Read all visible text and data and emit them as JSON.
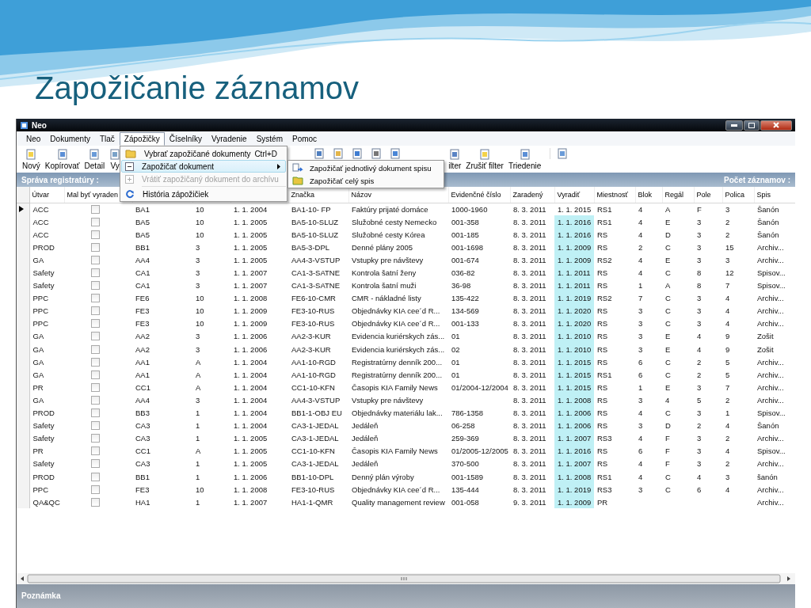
{
  "slide_title": "Zapožičanie záznamov",
  "window": {
    "title": "Neo"
  },
  "menu": [
    {
      "label": "Neo",
      "selected": false
    },
    {
      "label": "Dokumenty",
      "selected": false
    },
    {
      "label": "Tlač",
      "selected": false
    },
    {
      "label": "Zápožičky",
      "selected": true
    },
    {
      "label": "Číselníky",
      "selected": false
    },
    {
      "label": "Vyradenie",
      "selected": false
    },
    {
      "label": "Systém",
      "selected": false
    },
    {
      "label": "Pomoc",
      "selected": false
    }
  ],
  "dropdown": [
    {
      "label": "Vybrať zapožičané dokumenty",
      "shortcut": "Ctrl+D",
      "selected": false,
      "disabled": false
    },
    {
      "label": "Zapožičať dokument",
      "selected": true,
      "disabled": false,
      "submenu": [
        {
          "label": "Zapožičať jednotlivý dokument spisu"
        },
        {
          "label": "Zapožičať celý spis"
        }
      ]
    },
    {
      "label": "Vrátiť zapožičaný dokument do archívu",
      "selected": false,
      "disabled": true
    },
    {
      "label": "História zápožičiek",
      "selected": false,
      "disabled": false,
      "separator_before": true
    }
  ],
  "toolbar": [
    {
      "kind": "labeled",
      "label": "Nový"
    },
    {
      "kind": "labeled",
      "label": "Kopírovať"
    },
    {
      "kind": "labeled",
      "label": "Detail"
    },
    {
      "kind": "labeled",
      "label": "Vy"
    },
    {
      "kind": "icon"
    },
    {
      "kind": "icon"
    },
    {
      "kind": "icon"
    },
    {
      "kind": "icon"
    },
    {
      "kind": "icon"
    },
    {
      "kind": "labeled",
      "label": "ilter"
    },
    {
      "kind": "labeled",
      "label": "Zrušiť filter"
    },
    {
      "kind": "labeled",
      "label": "Triedenie"
    },
    {
      "kind": "icon"
    }
  ],
  "band": {
    "left": "Správa registratúry :",
    "right": "Počet záznamov :"
  },
  "table": {
    "columns": [
      {
        "label": "Útvar",
        "kind": "text"
      },
      {
        "label": "Mal byť vyraden",
        "kind": "checkbox"
      },
      {
        "kind": "text"
      },
      {
        "kind": "text"
      },
      {
        "kind": "text"
      },
      {
        "label": "Značka",
        "kind": "text"
      },
      {
        "label": "Názov",
        "kind": "text"
      },
      {
        "label": "Evidenčné číslo",
        "kind": "text"
      },
      {
        "label": "Zaradený",
        "kind": "text"
      },
      {
        "label": "Vyradiť",
        "kind": "due"
      },
      {
        "label": "Miestnosť",
        "kind": "text"
      },
      {
        "label": "Blok",
        "kind": "text"
      },
      {
        "label": "Regál",
        "kind": "text"
      },
      {
        "label": "Pole",
        "kind": "text"
      },
      {
        "label": "Polica",
        "kind": "text"
      },
      {
        "label": "Spis",
        "kind": "text"
      }
    ],
    "rows": [
      {
        "selected": true,
        "highlighted": false,
        "cells": [
          "ACC",
          false,
          "BA1",
          "10",
          "1. 1. 2004",
          "BA1-10- FP",
          "Faktúry prijaté domáce",
          "1000-1960",
          "8. 3. 2011",
          "1. 1. 2015",
          "RS1",
          "4",
          "A",
          "F",
          "3",
          "Šanón"
        ]
      },
      {
        "selected": false,
        "highlighted": true,
        "cells": [
          "ACC",
          false,
          "BA5",
          "10",
          "1. 1. 2005",
          "BA5-10-SLUZ",
          "Služobné cesty Nemecko",
          "001-358",
          "8. 3. 2011",
          "1. 1. 2016",
          "RS1",
          "4",
          "E",
          "3",
          "2",
          "Šanón"
        ]
      },
      {
        "selected": false,
        "highlighted": true,
        "cells": [
          "ACC",
          false,
          "BA5",
          "10",
          "1. 1. 2005",
          "BA5-10-SLUZ",
          "Služobné cesty Kórea",
          "001-185",
          "8. 3. 2011",
          "1. 1. 2016",
          "RS",
          "4",
          "D",
          "3",
          "2",
          "Šanón"
        ]
      },
      {
        "selected": false,
        "highlighted": true,
        "cells": [
          "PROD",
          false,
          "BB1",
          "3",
          "1. 1. 2005",
          "BA5-3-DPL",
          "Denné plány 2005",
          "001-1698",
          "8. 3. 2011",
          "1. 1. 2009",
          "RS",
          "2",
          "C",
          "3",
          "15",
          "Archiv..."
        ]
      },
      {
        "selected": false,
        "highlighted": true,
        "cells": [
          "GA",
          false,
          "AA4",
          "3",
          "1. 1. 2005",
          "AA4-3-VSTUP",
          "Vstupky pre návštevy",
          "001-674",
          "8. 3. 2011",
          "1. 1. 2009",
          "RS2",
          "4",
          "E",
          "3",
          "3",
          "Archiv..."
        ]
      },
      {
        "selected": false,
        "highlighted": true,
        "cells": [
          "Safety",
          false,
          "CA1",
          "3",
          "1. 1. 2007",
          "CA1-3-SATNE",
          "Kontrola šatní ženy",
          "036-82",
          "8. 3. 2011",
          "1. 1. 2011",
          "RS",
          "4",
          "C",
          "8",
          "12",
          "Spisov..."
        ]
      },
      {
        "selected": false,
        "highlighted": true,
        "cells": [
          "Safety",
          false,
          "CA1",
          "3",
          "1. 1. 2007",
          "CA1-3-SATNE",
          "Kontrola šatní muži",
          "36-98",
          "8. 3. 2011",
          "1. 1. 2011",
          "RS",
          "1",
          "A",
          "8",
          "7",
          "Spisov..."
        ]
      },
      {
        "selected": false,
        "highlighted": true,
        "cells": [
          "PPC",
          false,
          "FE6",
          "10",
          "1. 1. 2008",
          "FE6-10-CMR",
          "CMR - nákladné listy",
          "135-422",
          "8. 3. 2011",
          "1. 1. 2019",
          "RS2",
          "7",
          "C",
          "3",
          "4",
          "Archiv..."
        ]
      },
      {
        "selected": false,
        "highlighted": true,
        "cells": [
          "PPC",
          false,
          "FE3",
          "10",
          "1. 1. 2009",
          "FE3-10-RUS",
          "Objednávky KIA cee´d  R...",
          "134-569",
          "8. 3. 2011",
          "1. 1. 2020",
          "RS",
          "3",
          "C",
          "3",
          "4",
          "Archiv..."
        ]
      },
      {
        "selected": false,
        "highlighted": true,
        "cells": [
          "PPC",
          false,
          "FE3",
          "10",
          "1. 1. 2009",
          "FE3-10-RUS",
          "Objednávky KIA cee´d R...",
          "001-133",
          "8. 3. 2011",
          "1. 1. 2020",
          "RS",
          "3",
          "C",
          "3",
          "4",
          "Archiv..."
        ]
      },
      {
        "selected": false,
        "highlighted": true,
        "cells": [
          "GA",
          false,
          "AA2",
          "3",
          "1. 1. 2006",
          "AA2-3-KUR",
          "Evidencia kuriérskych zás...",
          "01",
          "8. 3. 2011",
          "1. 1. 2010",
          "RS",
          "3",
          "E",
          "4",
          "9",
          "Zošit"
        ]
      },
      {
        "selected": false,
        "highlighted": true,
        "cells": [
          "GA",
          false,
          "AA2",
          "3",
          "1. 1. 2006",
          "AA2-3-KUR",
          "Evidencia kuriérskych zás...",
          "02",
          "8. 3. 2011",
          "1. 1. 2010",
          "RS",
          "3",
          "E",
          "4",
          "9",
          "Zošit"
        ]
      },
      {
        "selected": false,
        "highlighted": true,
        "cells": [
          "GA",
          false,
          "AA1",
          "A",
          "1. 1. 2004",
          "AA1-10-RGD",
          "Registratúrny denník 200...",
          "01",
          "8. 3. 2011",
          "1. 1. 2015",
          "RS",
          "6",
          "C",
          "2",
          "5",
          "Archiv..."
        ]
      },
      {
        "selected": false,
        "highlighted": true,
        "cells": [
          "GA",
          false,
          "AA1",
          "A",
          "1. 1. 2004",
          "AA1-10-RGD",
          "Registratúrny denník 200...",
          "01",
          "8. 3. 2011",
          "1. 1. 2015",
          "RS1",
          "6",
          "C",
          "2",
          "5",
          "Archiv..."
        ]
      },
      {
        "selected": false,
        "highlighted": true,
        "cells": [
          "PR",
          false,
          "CC1",
          "A",
          "1. 1. 2004",
          "CC1-10-KFN",
          "Časopis KIA Family News",
          "01/2004-12/2004",
          "8. 3. 2011",
          "1. 1. 2015",
          "RS",
          "1",
          "E",
          "3",
          "7",
          "Archiv..."
        ]
      },
      {
        "selected": false,
        "highlighted": true,
        "cells": [
          "GA",
          false,
          "AA4",
          "3",
          "1. 1. 2004",
          "AA4-3-VSTUP",
          "Vstupky pre návštevy",
          null,
          "8. 3. 2011",
          "1. 1. 2008",
          "RS",
          "3",
          "4",
          "5",
          "2",
          "Archiv..."
        ]
      },
      {
        "selected": false,
        "highlighted": true,
        "cells": [
          "PROD",
          false,
          "BB3",
          "1",
          "1. 1. 2004",
          "BB1-1-OBJ EU",
          "Objednávky materiálu lak...",
          "786-1358",
          "8. 3. 2011",
          "1. 1. 2006",
          "RS",
          "4",
          "C",
          "3",
          "1",
          "Spisov..."
        ]
      },
      {
        "selected": false,
        "highlighted": true,
        "cells": [
          "Safety",
          false,
          "CA3",
          "1",
          "1. 1. 2004",
          "CA3-1-JEDAL",
          "Jedáleň",
          "06-258",
          "8. 3. 2011",
          "1. 1. 2006",
          "RS",
          "3",
          "D",
          "2",
          "4",
          "Šanón"
        ]
      },
      {
        "selected": false,
        "highlighted": true,
        "cells": [
          "Safety",
          false,
          "CA3",
          "1",
          "1. 1. 2005",
          "CA3-1-JEDAL",
          "Jedáleň",
          "259-369",
          "8. 3. 2011",
          "1. 1. 2007",
          "RS3",
          "4",
          "F",
          "3",
          "2",
          "Archiv..."
        ]
      },
      {
        "selected": false,
        "highlighted": true,
        "cells": [
          "PR",
          false,
          "CC1",
          "A",
          "1. 1. 2005",
          "CC1-10-KFN",
          "Časopis KIA Family News",
          "01/2005-12/2005",
          "8. 3. 2011",
          "1. 1. 2016",
          "RS",
          "6",
          "F",
          "3",
          "4",
          "Spisov..."
        ]
      },
      {
        "selected": false,
        "highlighted": true,
        "cells": [
          "Safety",
          false,
          "CA3",
          "1",
          "1. 1. 2005",
          "CA3-1-JEDAL",
          "Jedáleň",
          "370-500",
          "8. 3. 2011",
          "1. 1. 2007",
          "RS",
          "4",
          "F",
          "3",
          "2",
          "Archiv..."
        ]
      },
      {
        "selected": false,
        "highlighted": true,
        "cells": [
          "PROD",
          false,
          "BB1",
          "1",
          "1. 1. 2006",
          "BB1-10-DPL",
          "Denný plán výroby",
          "001-1589",
          "8. 3. 2011",
          "1. 1. 2008",
          "RS1",
          "4",
          "C",
          "4",
          "3",
          "šanón"
        ]
      },
      {
        "selected": false,
        "highlighted": true,
        "cells": [
          "PPC",
          false,
          "FE3",
          "10",
          "1. 1. 2008",
          "FE3-10-RUS",
          "Objednávky KIA cee´d  R...",
          "135-444",
          "8. 3. 2011",
          "1. 1. 2019",
          "RS3",
          "3",
          "C",
          "6",
          "4",
          "Archiv..."
        ]
      },
      {
        "selected": false,
        "highlighted": true,
        "cells": [
          "QA&QC",
          false,
          "HA1",
          "1",
          "1. 1. 2007",
          "HA1-1-QMR",
          "Quality management review",
          "001-058",
          "9. 3. 2011",
          "1. 1. 2009",
          "PR",
          null,
          null,
          null,
          null,
          "Archiv..."
        ]
      }
    ]
  },
  "footer": {
    "label": "Poznámka"
  }
}
